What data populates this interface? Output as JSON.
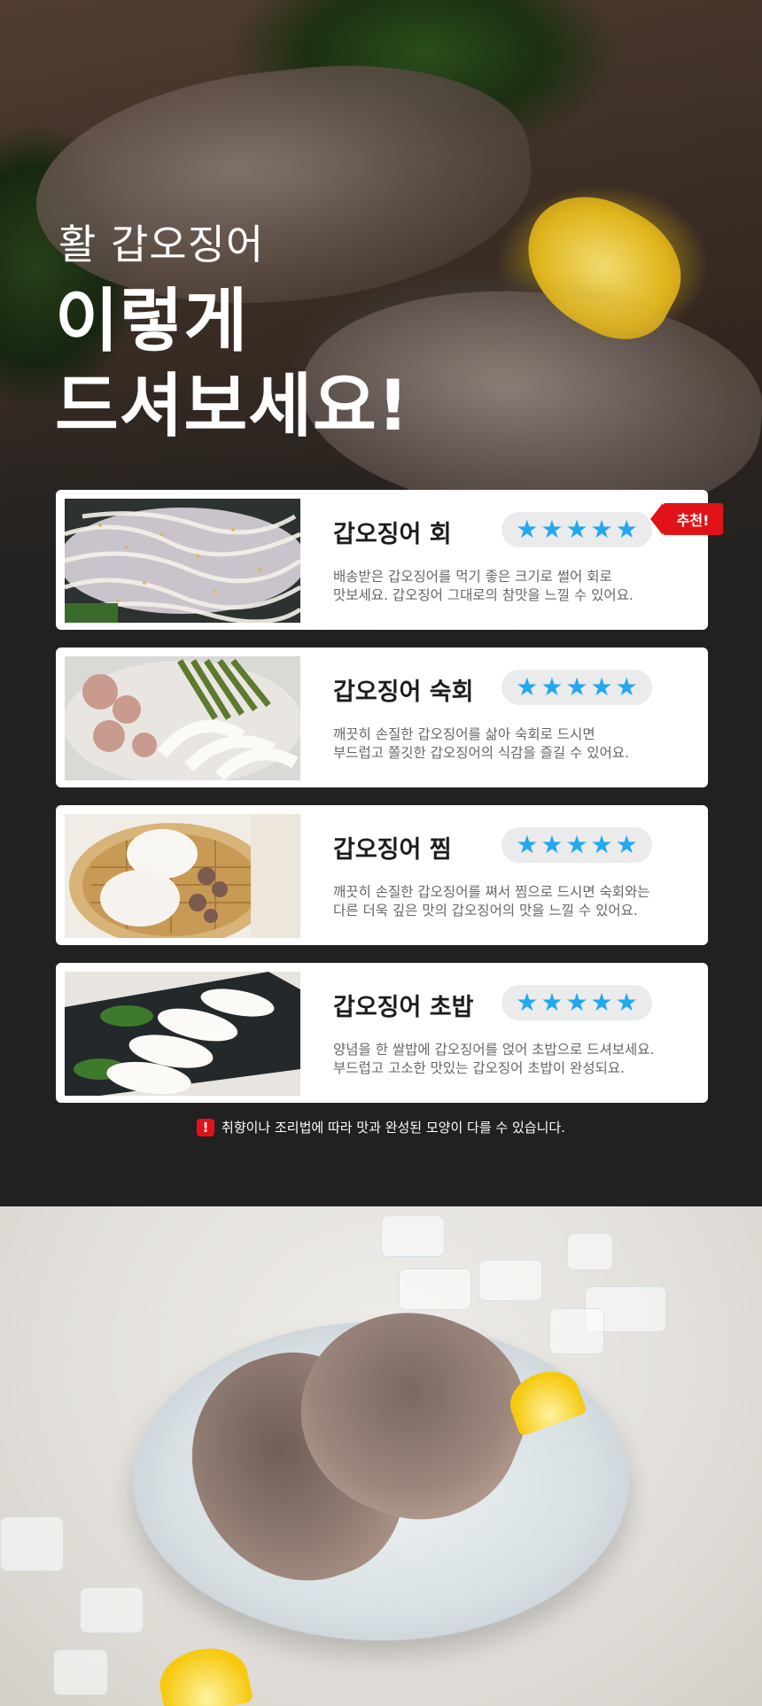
{
  "hero": {
    "subtitle": "활 갑오징어",
    "title_line1": "이렇게",
    "title_line2": "드셔보세요!"
  },
  "recommend_badge": "추천!",
  "star_icon": "★",
  "cards": [
    {
      "name": "갑오징어 회",
      "rating": 5,
      "desc_line1": "배송받은 갑오징어를 먹기 좋은 크기로 썰어 회로",
      "desc_line2": "맛보세요. 갑오징어 그대로의 참맛을 느낄 수 있어요."
    },
    {
      "name": "갑오징어 숙회",
      "rating": 5,
      "desc_line1": "깨끗히 손질한 갑오징어를 삶아 숙회로 드시면",
      "desc_line2": "부드럽고 쫄깃한 갑오징어의 식감을 즐길 수 있어요."
    },
    {
      "name": "갑오징어 찜",
      "rating": 5,
      "desc_line1": "깨끗히 손질한 갑오징어를 쪄서 찜으로 드시면 숙회와는",
      "desc_line2": "다른 더욱 깊은 맛의 갑오징어의 맛을 느낄 수 있어요."
    },
    {
      "name": "갑오징어 초밥",
      "rating": 5,
      "desc_line1": "양념을 한 쌀밥에 갑오징어를 얹어 초밥으로 드셔보세요.",
      "desc_line2": "부드럽고 고소한 맛있는 갑오징어 초밥이 완성되요."
    }
  ],
  "notice": {
    "icon": "!",
    "text": "취향이나 조리법에 따라 맛과 완성된 모양이 다를 수 있습니다."
  },
  "colors": {
    "accent_red": "#e11318",
    "star_blue": "#21a8f0",
    "dark_bg": "#212121"
  }
}
